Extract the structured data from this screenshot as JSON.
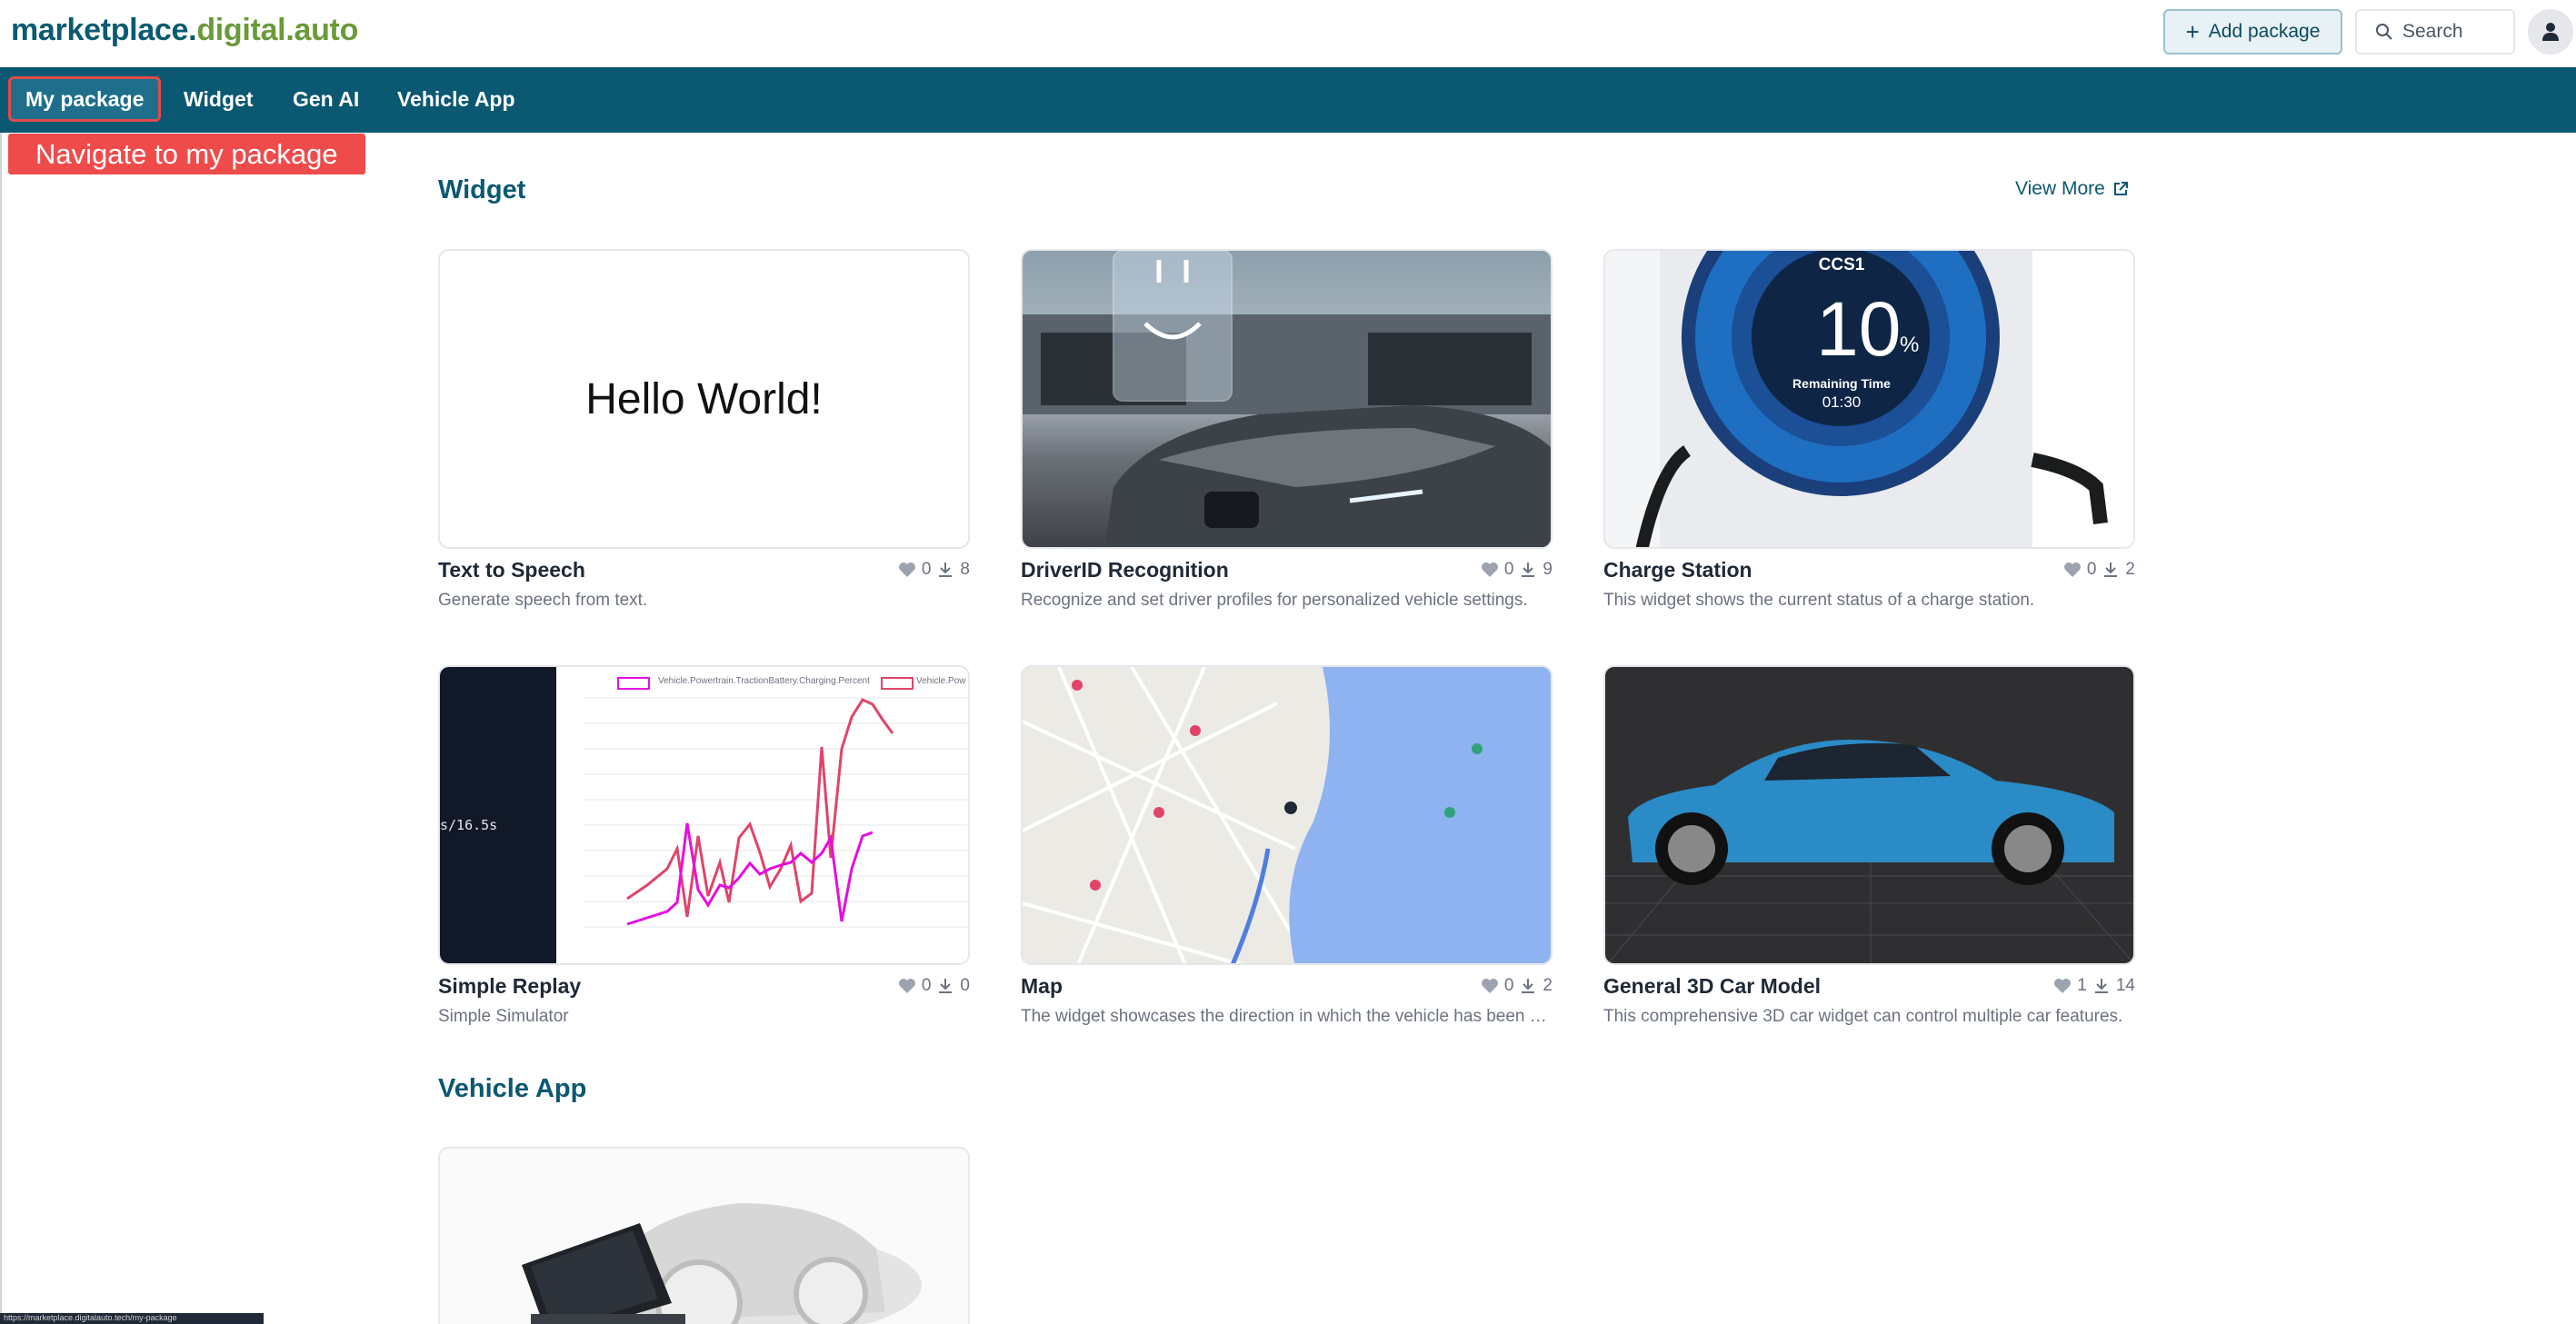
{
  "logo": {
    "part1": "marketplace.",
    "part2": "digital.auto"
  },
  "header": {
    "add_package": "Add package",
    "search_placeholder": "Search"
  },
  "nav": {
    "items": [
      {
        "label": "My package"
      },
      {
        "label": "Widget"
      },
      {
        "label": "Gen AI"
      },
      {
        "label": "Vehicle App"
      }
    ]
  },
  "hint": "Navigate to my package",
  "widget_section": {
    "title": "Widget",
    "view_more": "View More"
  },
  "widgets": [
    {
      "name": "Text to Speech",
      "likes": "0",
      "downloads": "8",
      "desc": "Generate speech from text.",
      "thumb_text": "Hello World!"
    },
    {
      "name": "DriverID Recognition",
      "likes": "0",
      "downloads": "9",
      "desc": "Recognize and set driver profiles for personalized vehicle settings."
    },
    {
      "name": "Charge Station",
      "likes": "0",
      "downloads": "2",
      "desc": "This widget shows the current status of a charge station.",
      "thumb": {
        "label": "CCS1",
        "value": "10",
        "unit": "%",
        "remaining_label": "Remaining Time",
        "remaining_value": "01:30"
      }
    },
    {
      "name": "Simple Replay",
      "likes": "0",
      "downloads": "0",
      "desc": "Simple Simulator",
      "thumb": {
        "time": "s/16.5s",
        "legend1": "Vehicle.Powertrain.TractionBattery.Charging.Percent",
        "legend2": "Vehicle.Pow"
      }
    },
    {
      "name": "Map",
      "likes": "0",
      "downloads": "2",
      "desc": "The widget showcases the direction in which the vehicle has been moving."
    },
    {
      "name": "General 3D Car Model",
      "likes": "1",
      "downloads": "14",
      "desc": "This comprehensive 3D car widget can control multiple car features."
    }
  ],
  "vehicle_app_section": {
    "title": "Vehicle App"
  },
  "statusbar": "https://marketplace.digitalauto.tech/my-package",
  "colors": {
    "brand": "#0b5873",
    "accent_green": "#6a9a3a",
    "highlight": "#ef4b4b"
  }
}
